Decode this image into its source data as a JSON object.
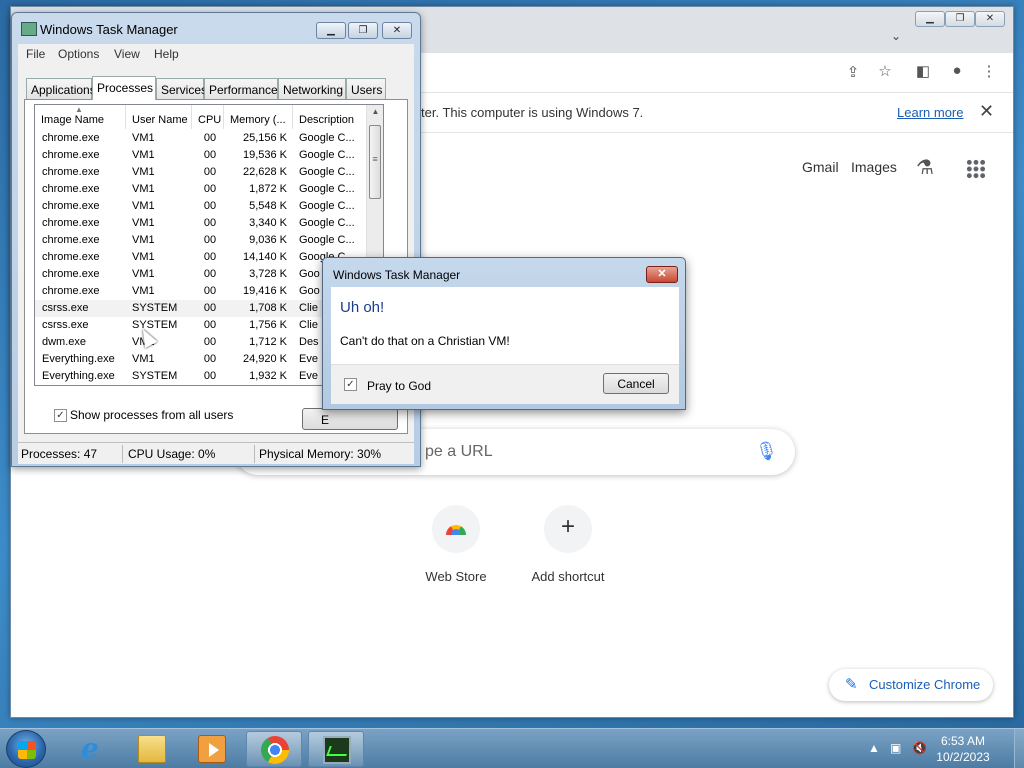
{
  "chrome": {
    "banner_text": "ter. This computer is using Windows 7.",
    "banner_link": "Learn more",
    "header_links": [
      "Gmail",
      "Images"
    ],
    "search_placeholder": "pe a URL",
    "shortcuts": [
      "Web Store",
      "Add shortcut"
    ],
    "customize_label": "Customize Chrome"
  },
  "task_manager": {
    "title": "Windows Task Manager",
    "menu": [
      "File",
      "Options",
      "View",
      "Help"
    ],
    "tabs": [
      "Applications",
      "Processes",
      "Services",
      "Performance",
      "Networking",
      "Users"
    ],
    "active_tab": "Processes",
    "columns": [
      "Image Name",
      "User Name",
      "CPU",
      "Memory (...",
      "Description"
    ],
    "rows": [
      [
        "chrome.exe",
        "VM1",
        "00",
        "25,156 K",
        "Google C..."
      ],
      [
        "chrome.exe",
        "VM1",
        "00",
        "19,536 K",
        "Google C..."
      ],
      [
        "chrome.exe",
        "VM1",
        "00",
        "22,628 K",
        "Google C..."
      ],
      [
        "chrome.exe",
        "VM1",
        "00",
        "1,872 K",
        "Google C..."
      ],
      [
        "chrome.exe",
        "VM1",
        "00",
        "5,548 K",
        "Google C..."
      ],
      [
        "chrome.exe",
        "VM1",
        "00",
        "3,340 K",
        "Google C..."
      ],
      [
        "chrome.exe",
        "VM1",
        "00",
        "9,036 K",
        "Google C..."
      ],
      [
        "chrome.exe",
        "VM1",
        "00",
        "14,140 K",
        "Google C..."
      ],
      [
        "chrome.exe",
        "VM1",
        "00",
        "3,728 K",
        "Goo"
      ],
      [
        "chrome.exe",
        "VM1",
        "00",
        "19,416 K",
        "Goo"
      ],
      [
        "csrss.exe",
        "SYSTEM",
        "00",
        "1,708 K",
        "Clie"
      ],
      [
        "csrss.exe",
        "SYSTEM",
        "00",
        "1,756 K",
        "Clie"
      ],
      [
        "dwm.exe",
        "VM1",
        "00",
        "1,712 K",
        "Des"
      ],
      [
        "Everything.exe",
        "VM1",
        "00",
        "24,920 K",
        "Eve"
      ],
      [
        "Everything.exe",
        "SYSTEM",
        "00",
        "1,932 K",
        "Eve"
      ]
    ],
    "selected_row": 10,
    "show_all_label": "Show processes from all users",
    "show_all_checked": true,
    "end_button": "E",
    "status": {
      "processes": "Processes: 47",
      "cpu": "CPU Usage: 0%",
      "memory": "Physical Memory: 30%"
    }
  },
  "dialog": {
    "title": "Windows Task Manager",
    "heading": "Uh oh!",
    "message": "Can't do that on a Christian VM!",
    "checkbox_label": "Pray to God",
    "checkbox_checked": true,
    "cancel_label": "Cancel"
  },
  "taskbar": {
    "time": "6:53 AM",
    "date": "10/2/2023"
  }
}
